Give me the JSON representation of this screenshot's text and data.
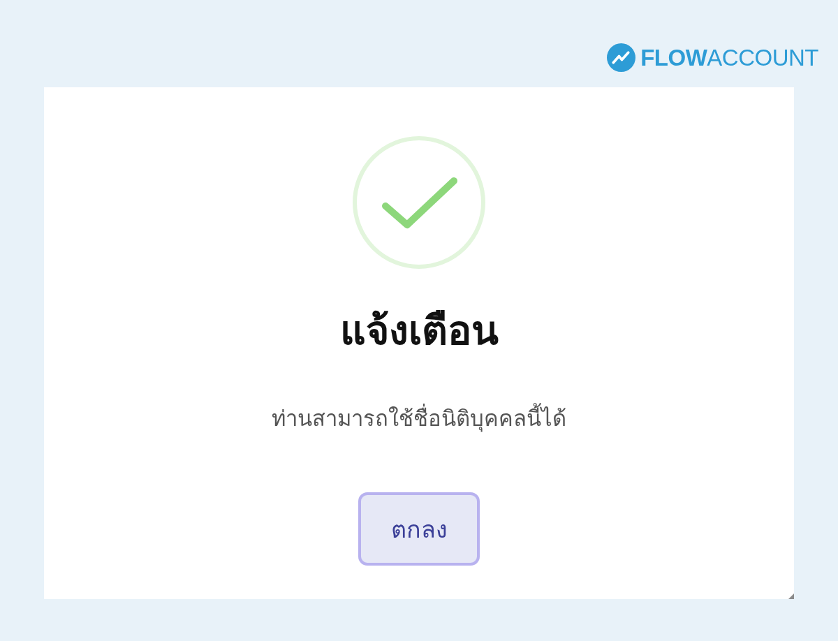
{
  "header": {
    "logo": "**FLOW**ACCOUNT"
  },
  "dialog": {
    "title": "แจ้งเตือน",
    "message": "ท่านสามารถใช้ชื่อนิติบุคคลนี้ได้",
    "button": {
      "label": "ตกลง",
      "focused": true
    }
  }
}
